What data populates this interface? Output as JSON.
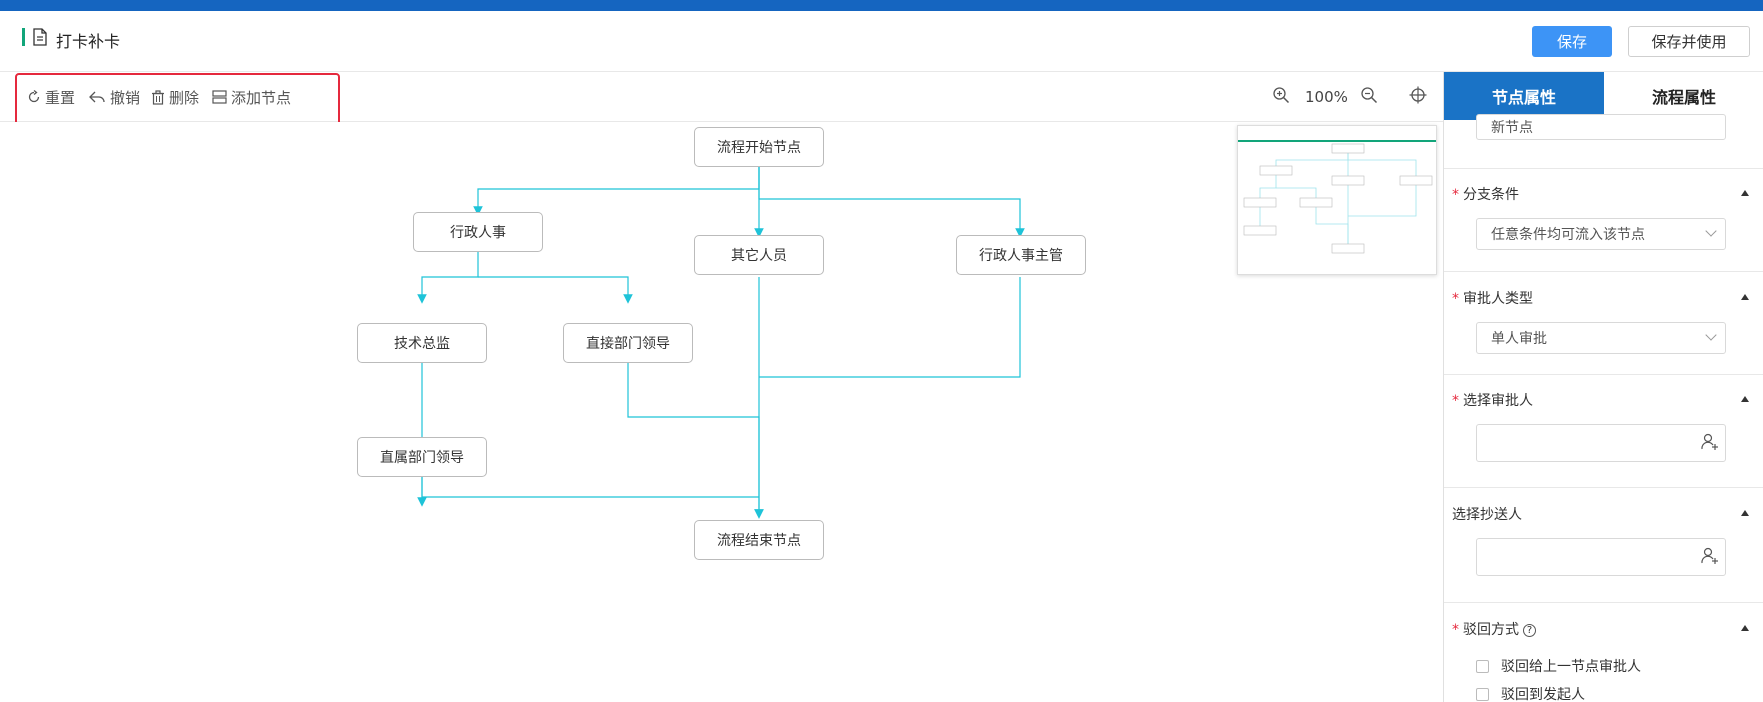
{
  "header": {
    "title": "打卡补卡",
    "save_label": "保存",
    "save_and_use_label": "保存并使用"
  },
  "toolbar": {
    "reset_label": "重置",
    "undo_label": "撤销",
    "delete_label": "删除",
    "add_node_label": "添加节点",
    "zoom_level": "100%"
  },
  "flow": {
    "nodes": {
      "start": "流程开始节点",
      "admin_hr": "行政人事",
      "others": "其它人员",
      "admin_hr_manager": "行政人事主管",
      "tech_director": "技术总监",
      "direct_dept_leader": "直接部门领导",
      "affiliated_dept_leader": "直属部门领导",
      "end": "流程结束节点"
    }
  },
  "panel": {
    "tabs": [
      "节点属性",
      "流程属性"
    ],
    "node_name_value": "新节点",
    "branch_condition_label": "分支条件",
    "branch_condition_value": "任意条件均可流入该节点",
    "approver_type_label": "审批人类型",
    "approver_type_value": "单人审批",
    "select_approver_label": "选择审批人",
    "select_cc_label": "选择抄送人",
    "reject_method_label": "驳回方式",
    "reject_options": [
      "驳回给上一节点审批人",
      "驳回到发起人"
    ]
  },
  "colors": {
    "top_stripe": "#1565c0",
    "primary": "#3d94f6",
    "active_tab": "#1a73c6",
    "edge": "#1ec3d8",
    "highlight": "#e5293d"
  }
}
